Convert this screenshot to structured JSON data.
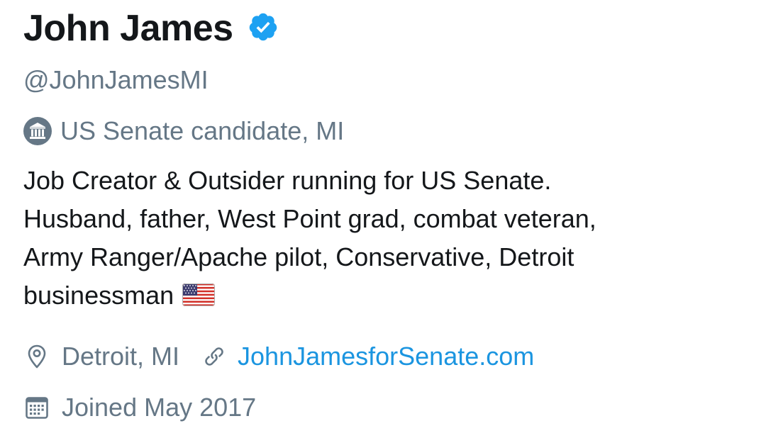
{
  "profile": {
    "display_name": "John James",
    "verified": true,
    "handle": "@JohnJamesMI",
    "label_icon": "government-building-icon",
    "label_text": "US Senate candidate, MI",
    "bio_lines": [
      "Job Creator & Outsider running for US Senate.",
      "Husband, father, West Point grad, combat veteran,",
      "Army Ranger/Apache pilot, Conservative, Detroit",
      "businessman"
    ],
    "bio_emoji": "us-flag-emoji",
    "location_icon": "location-pin-icon",
    "location": "Detroit, MI",
    "website_icon": "link-icon",
    "website": "JohnJamesforSenate.com",
    "joined_icon": "calendar-icon",
    "joined": "Joined May 2017"
  },
  "colors": {
    "text_primary": "#14171a",
    "text_secondary": "#657786",
    "link": "#1b95e0",
    "verified_badge": "#1da1f2"
  }
}
